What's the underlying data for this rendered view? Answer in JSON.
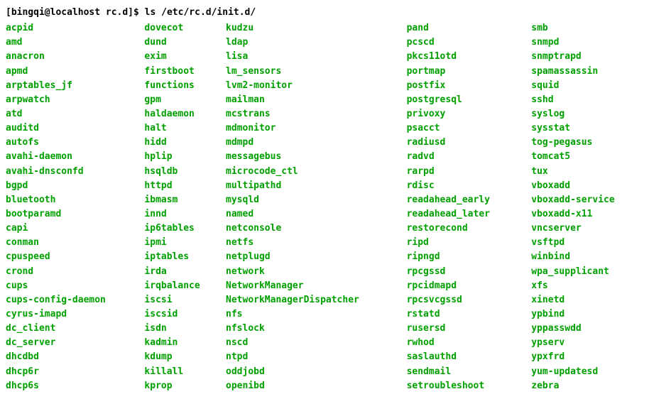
{
  "prompt": {
    "user_host_cwd": "[bingqi@localhost rc.d]$",
    "command": "ls /etc/rc.d/init.d/"
  },
  "listing": {
    "col1": [
      "acpid",
      "amd",
      "anacron",
      "apmd",
      "arptables_jf",
      "arpwatch",
      "atd",
      "auditd",
      "autofs",
      "avahi-daemon",
      "avahi-dnsconfd",
      "bgpd",
      "bluetooth",
      "bootparamd",
      "capi",
      "conman",
      "cpuspeed",
      "crond",
      "cups",
      "cups-config-daemon",
      "cyrus-imapd",
      "dc_client",
      "dc_server",
      "dhcdbd",
      "dhcp6r",
      "dhcp6s"
    ],
    "col2": [
      "dovecot",
      "dund",
      "exim",
      "firstboot",
      "functions",
      "gpm",
      "haldaemon",
      "halt",
      "hidd",
      "hplip",
      "hsqldb",
      "httpd",
      "ibmasm",
      "innd",
      "ip6tables",
      "ipmi",
      "iptables",
      "irda",
      "irqbalance",
      "iscsi",
      "iscsid",
      "isdn",
      "kadmin",
      "kdump",
      "killall",
      "kprop"
    ],
    "col3": [
      "kudzu",
      "ldap",
      "lisa",
      "lm_sensors",
      "lvm2-monitor",
      "mailman",
      "mcstrans",
      "mdmonitor",
      "mdmpd",
      "messagebus",
      "microcode_ctl",
      "multipathd",
      "mysqld",
      "named",
      "netconsole",
      "netfs",
      "netplugd",
      "network",
      "NetworkManager",
      "NetworkManagerDispatcher",
      "nfs",
      "nfslock",
      "nscd",
      "ntpd",
      "oddjobd",
      "openibd"
    ],
    "col4": [
      "pand",
      "pcscd",
      "pkcs11otd",
      "portmap",
      "postfix",
      "postgresql",
      "privoxy",
      "psacct",
      "radiusd",
      "radvd",
      "rarpd",
      "rdisc",
      "readahead_early",
      "readahead_later",
      "restorecond",
      "ripd",
      "ripngd",
      "rpcgssd",
      "rpcidmapd",
      "rpcsvcgssd",
      "rstatd",
      "rusersd",
      "rwhod",
      "saslauthd",
      "sendmail",
      "setroubleshoot"
    ],
    "col5": [
      "smb",
      "snmpd",
      "snmptrapd",
      "spamassassin",
      "squid",
      "sshd",
      "syslog",
      "sysstat",
      "tog-pegasus",
      "tomcat5",
      "tux",
      "vboxadd",
      "vboxadd-service",
      "vboxadd-x11",
      "vncserver",
      "vsftpd",
      "winbind",
      "wpa_supplicant",
      "xfs",
      "xinetd",
      "ypbind",
      "yppasswdd",
      "ypserv",
      "ypxfrd",
      "yum-updatesd",
      "zebra"
    ]
  }
}
